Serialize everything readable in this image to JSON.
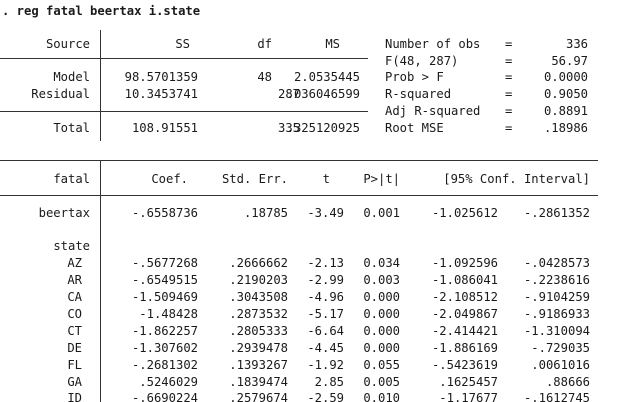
{
  "command": ". reg fatal beertax i.state",
  "anova": {
    "headers": [
      "Source",
      "SS",
      "df",
      "MS"
    ],
    "rows": [
      {
        "source": "Model",
        "ss": "98.5701359",
        "df": "48",
        "ms": "2.0535445"
      },
      {
        "source": "Residual",
        "ss": "10.3453741",
        "df": "287",
        "ms": ".036046599"
      },
      {
        "source": "Total",
        "ss": "108.91551",
        "df": "335",
        "ms": ".325120925"
      }
    ]
  },
  "stats": [
    {
      "label": "Number of obs",
      "eq": "=",
      "value": "336"
    },
    {
      "label": "F(48, 287)",
      "eq": "=",
      "value": "56.97"
    },
    {
      "label": "Prob > F",
      "eq": "=",
      "value": "0.0000"
    },
    {
      "label": "R-squared",
      "eq": "=",
      "value": "0.9050"
    },
    {
      "label": "Adj R-squared",
      "eq": "=",
      "value": "0.8891"
    },
    {
      "label": "Root MSE",
      "eq": "=",
      "value": ".18986"
    }
  ],
  "coef": {
    "headers": [
      "fatal",
      "Coef.",
      "Std. Err.",
      "t",
      "P>|t|",
      "[95% Conf. Interval]"
    ],
    "beertax": {
      "name": "beertax",
      "coef": "-.6558736",
      "se": ".18785",
      "t": "-3.49",
      "p": "0.001",
      "lo": "-1.025612",
      "hi": "-.2861352"
    },
    "factor_label": "state",
    "states": [
      {
        "name": "AZ",
        "coef": "-.5677268",
        "se": ".2666662",
        "t": "-2.13",
        "p": "0.034",
        "lo": "-1.092596",
        "hi": "-.0428573"
      },
      {
        "name": "AR",
        "coef": "-.6549515",
        "se": ".2190203",
        "t": "-2.99",
        "p": "0.003",
        "lo": "-1.086041",
        "hi": "-.2238616"
      },
      {
        "name": "CA",
        "coef": "-1.509469",
        "se": ".3043508",
        "t": "-4.96",
        "p": "0.000",
        "lo": "-2.108512",
        "hi": "-.9104259"
      },
      {
        "name": "CO",
        "coef": "-1.48428",
        "se": ".2873532",
        "t": "-5.17",
        "p": "0.000",
        "lo": "-2.049867",
        "hi": "-.9186933"
      },
      {
        "name": "CT",
        "coef": "-1.862257",
        "se": ".2805333",
        "t": "-6.64",
        "p": "0.000",
        "lo": "-2.414421",
        "hi": "-1.310094"
      },
      {
        "name": "DE",
        "coef": "-1.307602",
        "se": ".2939478",
        "t": "-4.45",
        "p": "0.000",
        "lo": "-1.886169",
        "hi": "-.729035"
      },
      {
        "name": "FL",
        "coef": "-.2681302",
        "se": ".1393267",
        "t": "-1.92",
        "p": "0.055",
        "lo": "-.5423619",
        "hi": ".0061016"
      },
      {
        "name": "GA",
        "coef": ".5246029",
        "se": ".1839474",
        "t": "2.85",
        "p": "0.005",
        "lo": ".1625457",
        "hi": ".88666"
      },
      {
        "name": "ID",
        "coef": "-.6690224",
        "se": ".2579674",
        "t": "-2.59",
        "p": "0.010",
        "lo": "-1.17677",
        "hi": "-.1612745"
      }
    ]
  }
}
